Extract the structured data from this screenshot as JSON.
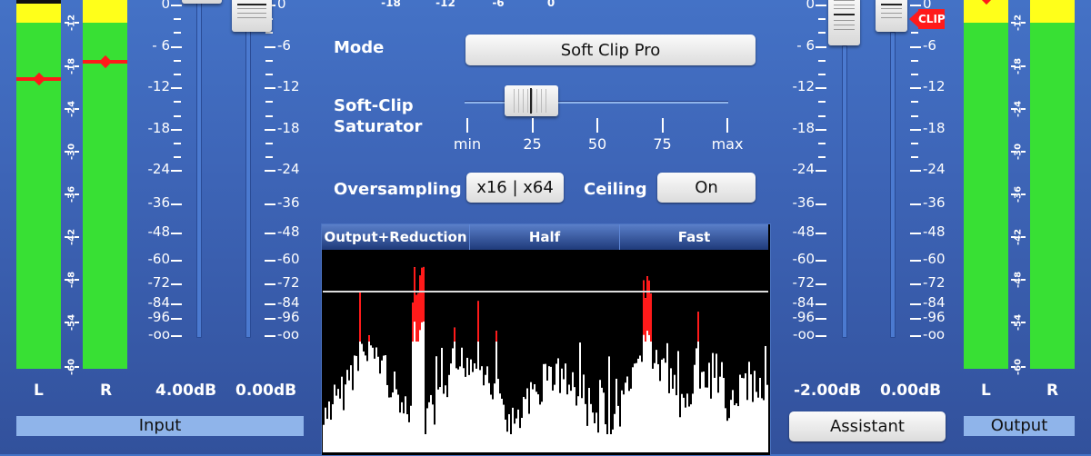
{
  "top_scale": {
    "ticks": [
      "-18",
      "-12",
      "-6",
      "0"
    ]
  },
  "input": {
    "section_label": "Input",
    "meters": [
      {
        "channel": "L",
        "peak_db": -20.5,
        "clip": true
      },
      {
        "channel": "R",
        "peak_db": -17.0,
        "clip": false
      }
    ],
    "meter_scale": [
      "-12",
      "-18",
      "-24",
      "-30",
      "-36",
      "-42",
      "-48",
      "-54",
      "-60"
    ],
    "fader_scale": [
      "0",
      "- 6",
      "-12",
      "-18",
      "-24",
      "-36",
      "-48",
      "-60",
      "-72",
      "-84",
      "-96",
      "-oo"
    ],
    "fader_scale_right": [
      "0",
      "-6",
      "-12",
      "-18",
      "-24",
      "-36",
      "-48",
      "-60",
      "-72",
      "-84",
      "-96",
      "-oo"
    ],
    "gain_value": "4.00dB",
    "level_value": "0.00dB",
    "gain_fader_db": 4.0,
    "level_fader_db": 0.0
  },
  "center": {
    "mode": {
      "label": "Mode",
      "value": "Soft Clip Pro"
    },
    "saturator": {
      "label_line1": "Soft-Clip",
      "label_line2": "Saturator",
      "ticks": [
        "min",
        "25",
        "50",
        "75",
        "max"
      ],
      "value_percent": 22
    },
    "oversampling": {
      "label": "Oversampling",
      "value": "x16 | x64"
    },
    "ceiling": {
      "label": "Ceiling",
      "value": "On"
    },
    "display_tabs": [
      "Output+Reduction",
      "Half",
      "Fast"
    ]
  },
  "output": {
    "section_label": "Output",
    "meters": [
      {
        "channel": "L",
        "peak_db": -10.5,
        "clip": false
      },
      {
        "channel": "R",
        "peak_db": null,
        "clip": false
      }
    ],
    "meter_scale": [
      "-12",
      "-18",
      "-24",
      "-30",
      "-36",
      "-42",
      "-48",
      "-54",
      "-60"
    ],
    "fader_scale": [
      "0",
      "- 6",
      "-12",
      "-18",
      "-24",
      "-36",
      "-48",
      "-60",
      "-72",
      "-84",
      "-96",
      "-oo"
    ],
    "fader_scale_right": [
      "0",
      "-6",
      "-12",
      "-18",
      "-24",
      "-36",
      "-48",
      "-60",
      "-72",
      "-84",
      "-96",
      "-oo"
    ],
    "gain_value": "-2.00dB",
    "level_value": "0.00dB",
    "clip_indicator": "CLIP",
    "assistant_button": "Assistant"
  },
  "colors": {
    "meter_green": "#38e034",
    "meter_yellow": "#ffff1a",
    "peak_red": "#ff1a1a",
    "clip_red": "#ff1a1a"
  }
}
